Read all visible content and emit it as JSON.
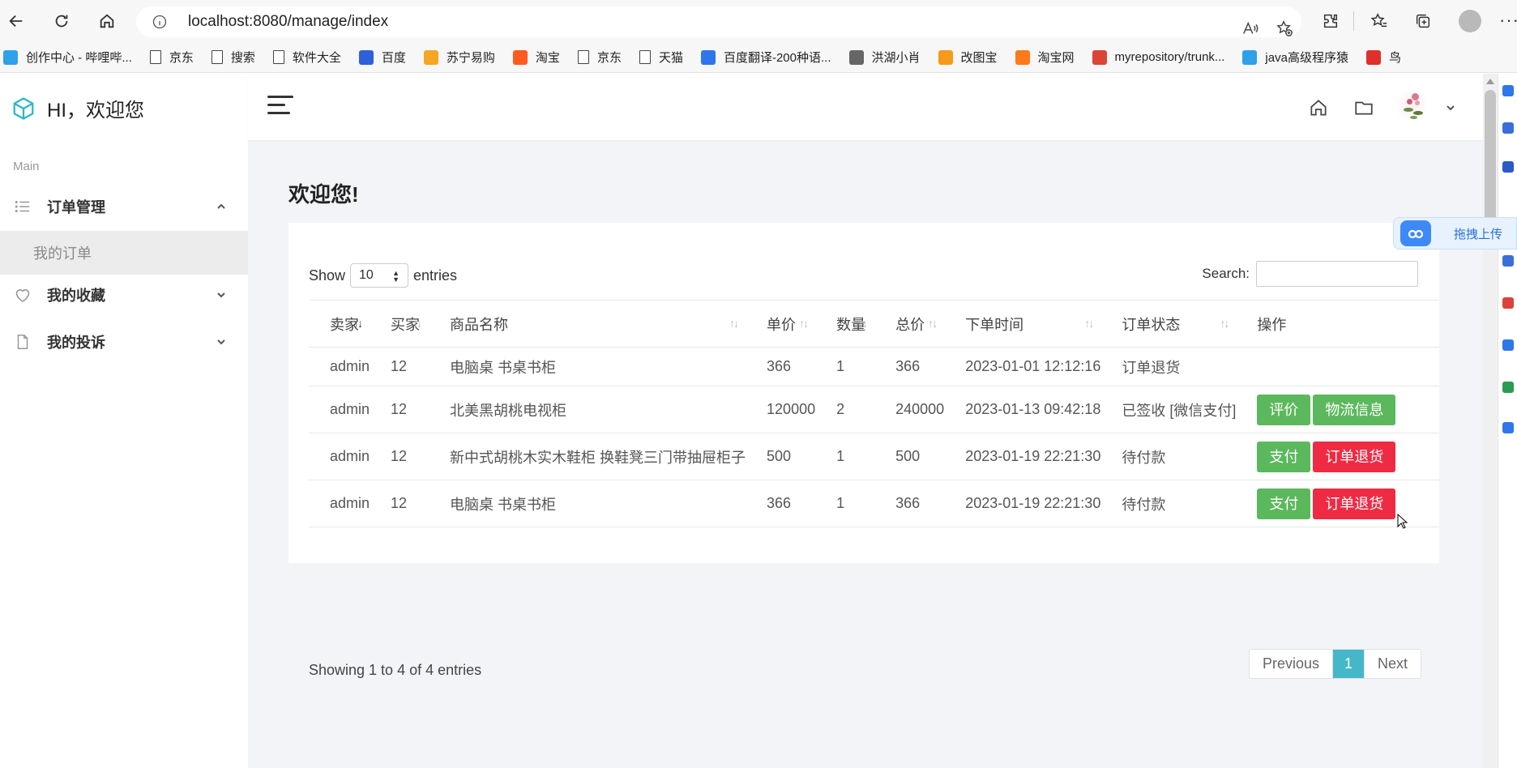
{
  "browser": {
    "url": "localhost:8080/manage/index",
    "bookmarks": [
      {
        "label": "创作中心 - 哔哩哔...",
        "icon": "bilibili-icon",
        "color": "#2ea1e8"
      },
      {
        "label": "京东",
        "icon": "page-icon"
      },
      {
        "label": "搜索",
        "icon": "page-icon"
      },
      {
        "label": "软件大全",
        "icon": "page-icon"
      },
      {
        "label": "百度",
        "icon": "baidu-paw-icon",
        "color": "#3060d8"
      },
      {
        "label": "苏宁易购",
        "icon": "suning-icon",
        "color": "#f5a623"
      },
      {
        "label": "淘宝",
        "icon": "taobao-icon",
        "color": "#ff5a1f"
      },
      {
        "label": "京东",
        "icon": "page-icon"
      },
      {
        "label": "天猫",
        "icon": "page-icon"
      },
      {
        "label": "百度翻译-200种语...",
        "icon": "baidu-translate-icon",
        "color": "#2f76ea"
      },
      {
        "label": "洪湖小肖",
        "icon": "feather-icon",
        "color": "#666666"
      },
      {
        "label": "改图宝",
        "icon": "gaitubao-icon",
        "color": "#f59a1a"
      },
      {
        "label": "淘宝网",
        "icon": "taobao-icon",
        "color": "#ff7a1a"
      },
      {
        "label": "myrepository/trunk...",
        "icon": "chrome-icon",
        "color": "#db4437"
      },
      {
        "label": "java高级程序猿",
        "icon": "bilibili-icon",
        "color": "#2ea1e8"
      },
      {
        "label": "鸟",
        "icon": "bird-icon",
        "color": "#e0302a"
      }
    ]
  },
  "sidebar": {
    "brand": "HI，欢迎您",
    "caption": "Main",
    "items": [
      {
        "label": "订单管理",
        "icon": "list-icon",
        "expanded": true
      },
      {
        "label": "我的收藏",
        "icon": "heart-icon",
        "expanded": false
      },
      {
        "label": "我的投诉",
        "icon": "file-icon",
        "expanded": false
      }
    ],
    "submenu": "我的订单"
  },
  "page": {
    "title": "欢迎您!"
  },
  "table_controls": {
    "show_label": "Show",
    "page_length": "10",
    "entries_label": "entries",
    "search_label": "Search:"
  },
  "table": {
    "columns": [
      "卖家",
      "买家",
      "商品名称",
      "单价",
      "数量",
      "总价",
      "下单时间",
      "订单状态",
      "操作"
    ],
    "rows": [
      {
        "seller": "admin",
        "buyer": "12",
        "product": "电脑桌 书桌书柜",
        "price": "366",
        "qty": "1",
        "total": "366",
        "time": "2023-01-01 12:12:16",
        "status": "订单退货",
        "actions": []
      },
      {
        "seller": "admin",
        "buyer": "12",
        "product": "北美黑胡桃电视柜",
        "price": "120000",
        "qty": "2",
        "total": "240000",
        "time": "2023-01-13 09:42:18",
        "status": "已签收 [微信支付]",
        "actions": [
          {
            "label": "评价",
            "style": "green"
          },
          {
            "label": "物流信息",
            "style": "green"
          }
        ]
      },
      {
        "seller": "admin",
        "buyer": "12",
        "product": "新中式胡桃木实木鞋柜 换鞋凳三门带抽屉柜子",
        "price": "500",
        "qty": "1",
        "total": "500",
        "time": "2023-01-19 22:21:30",
        "status": "待付款",
        "actions": [
          {
            "label": "支付",
            "style": "green"
          },
          {
            "label": "订单退货",
            "style": "red"
          }
        ]
      },
      {
        "seller": "admin",
        "buyer": "12",
        "product": "电脑桌 书桌书柜",
        "price": "366",
        "qty": "1",
        "total": "366",
        "time": "2023-01-19 22:21:30",
        "status": "待付款",
        "actions": [
          {
            "label": "支付",
            "style": "green"
          },
          {
            "label": "订单退货",
            "style": "red"
          }
        ]
      }
    ]
  },
  "footer": {
    "info": "Showing 1 to 4 of 4 entries",
    "previous": "Previous",
    "current_page": "1",
    "next": "Next"
  },
  "float_upload": {
    "label": "拖拽上传"
  },
  "colors": {
    "accent": "#45b7c8",
    "green_button": "#5cb85c",
    "red_button": "#ef2b44"
  }
}
